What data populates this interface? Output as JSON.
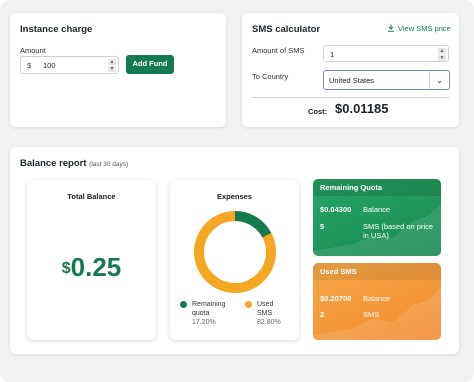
{
  "instance_charge": {
    "title": "Instance charge",
    "amount_label": "Amount",
    "currency_symbol": "$",
    "amount_value": "100",
    "add_fund_label": "Add Fund"
  },
  "sms_calculator": {
    "title": "SMS calculator",
    "view_price_link": "View SMS price",
    "amount_label": "Amount of SMS",
    "amount_value": "1",
    "country_label": "To Country",
    "country_value": "United States",
    "cost_label": "Cost:",
    "cost_value": "$0.01185"
  },
  "balance_report": {
    "title": "Balance report",
    "subtitle": "(last 30 days)",
    "total_balance": {
      "title": "Total Balance",
      "currency_symbol": "$",
      "value": "0.25"
    },
    "expenses": {
      "title": "Expenses",
      "colors": {
        "remaining": "#147a4f",
        "used": "#f5a623"
      },
      "items": [
        {
          "label_line1": "Remaining",
          "label_line2": "quota",
          "percent_text": "17.20%",
          "percent": 17.2
        },
        {
          "label_line1": "Used",
          "label_line2": "SMS",
          "percent_text": "82.80%",
          "percent": 82.8
        }
      ]
    },
    "remaining_quota": {
      "title": "Remaining Quota",
      "amount": "$0.04300",
      "amount_label": "Balance",
      "count": "5",
      "count_label_line1": "SMS (based on price",
      "count_label_line2": "in USA)"
    },
    "used_sms": {
      "title": "Used SMS",
      "amount": "$0.20700",
      "amount_label": "Balance",
      "count": "2",
      "count_label": "SMS"
    }
  }
}
